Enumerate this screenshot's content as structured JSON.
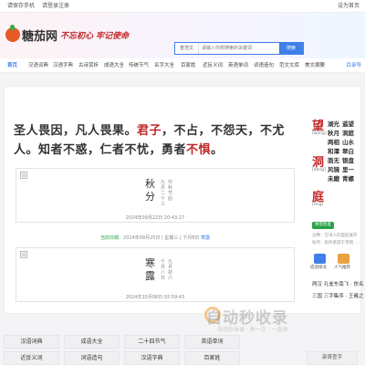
{
  "topbar": {
    "left": [
      "请保存手机",
      "请登录注册"
    ],
    "right": "设为首页"
  },
  "logo": {
    "text": "糖茄网"
  },
  "slogan": "不忘初心 牢记使命",
  "search": {
    "category": "查范文",
    "placeholder": "请输入你想搜索的关键词",
    "button": "搜索"
  },
  "nav": {
    "items": [
      "首页",
      "汉语词典",
      "汉语字典",
      "古诗赏析",
      "成语大全",
      "传统节气",
      "名字大全",
      "百家姓",
      "近反义词",
      "英语单词",
      "词语造句",
      "范文文库",
      "美文摘要"
    ],
    "more": "目录导"
  },
  "quote": {
    "p1": "圣人畏因，凡人畏果。",
    "h1": "君子",
    "p2": "，不占，不怨天，不尤人。知者不惑，仁者不忧，勇者",
    "h2": "不惧",
    "p3": "。"
  },
  "cards": [
    {
      "title": "秋分",
      "side": "九月二十三",
      "side2": "中秋节后",
      "date": "2024年09月22日 20:43:27"
    },
    {
      "title": "寒露",
      "side": "十月八日",
      "side2": "九月初六",
      "date": "2024年10月08日 02:59:43"
    }
  ],
  "info": {
    "label": "当前日期：",
    "date": "2024年09月25日 | 星期三 | 下月8日",
    "tail": "寒露"
  },
  "right": {
    "chars": [
      "望",
      "洞",
      "庭"
    ],
    "pinyin": [
      "[wàng]",
      "[dòng]",
      "[tíng]"
    ],
    "col1": "湖光秋月两相和潭面无风镜未磨",
    "col2": "遥望洞庭山水翠白银盘里一青螺",
    "tag": "拼音检查",
    "small1": "注释：在诗人的面前展开",
    "small2": "秋月：指作者游于宵明……",
    "icons": [
      "成语接龙",
      "人气推荐"
    ],
    "lines": [
      "两汉  孔雀东南飞 · 佚名",
      "三国  三字集序 · 王羲之"
    ]
  },
  "watermark": {
    "main": "自动秒收录",
    "sub": "自动秒收录 · 来一次 · 一直来"
  },
  "grid": {
    "row1": [
      "汉语词典",
      "成语大全",
      "二十四节气",
      "英语单词"
    ],
    "row2": [
      "近反义词",
      "词语造句",
      "汉语字典",
      "百家姓"
    ],
    "right": [
      "部首查字"
    ]
  },
  "colors": {
    "accent": "#3f7fe8",
    "red": "#c0282a",
    "green": "#2aa147"
  }
}
